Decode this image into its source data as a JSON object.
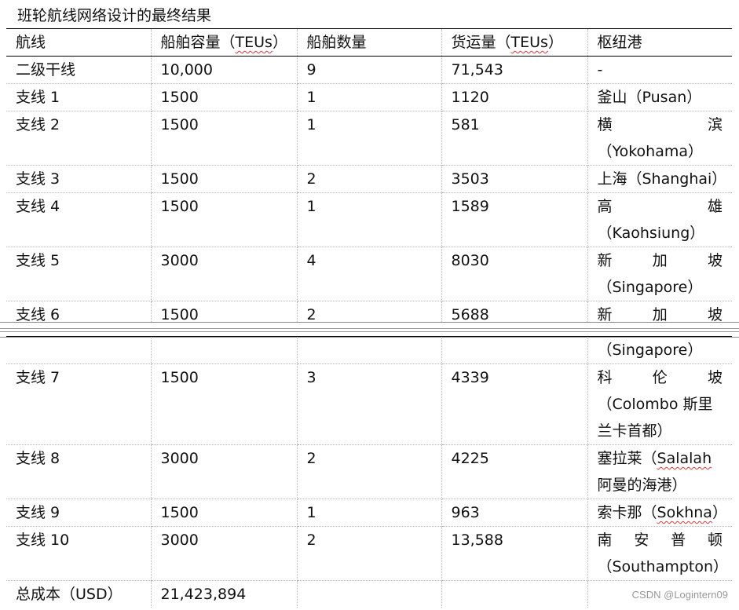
{
  "caption": "班轮航线网络设计的最终结果",
  "headers": {
    "route": "航线",
    "capacity_prefix": "船舶容量（",
    "capacity_unit": "TEUs",
    "capacity_suffix": "）",
    "ship_count": "船舶数量",
    "volume_prefix": "货运量（",
    "volume_unit": "TEUs",
    "volume_suffix": "）",
    "hub": "枢纽港"
  },
  "rows": [
    {
      "route": "二级干线",
      "capacity": "10,000",
      "ships": "9",
      "volume": "71,543",
      "hub": "-"
    },
    {
      "route": "支线 1",
      "capacity": "1500",
      "ships": "1",
      "volume": "1120",
      "hub": "釜山（Pusan）"
    },
    {
      "route": "支线 2",
      "capacity": "1500",
      "ships": "1",
      "volume": "581",
      "hub_chars": [
        "横",
        "滨"
      ],
      "hub_line2": "（Yokohama）"
    },
    {
      "route": "支线 3",
      "capacity": "1500",
      "ships": "2",
      "volume": "3503",
      "hub": "上海（Shanghai）"
    },
    {
      "route": "支线 4",
      "capacity": "1500",
      "ships": "1",
      "volume": "1589",
      "hub_chars": [
        "高",
        "雄"
      ],
      "hub_line2": "（Kaohsiung）"
    },
    {
      "route": "支线 5",
      "capacity": "3000",
      "ships": "4",
      "volume": "8030",
      "hub_chars": [
        "新",
        "加",
        "坡"
      ],
      "hub_line2": "（Singapore）"
    },
    {
      "route": "支线 6",
      "capacity": "1500",
      "ships": "2",
      "volume": "5688",
      "hub_chars": [
        "新",
        "加",
        "坡"
      ],
      "hub_line2": "（Singapore）"
    },
    {
      "route": "支线 7",
      "capacity": "1500",
      "ships": "3",
      "volume": "4339",
      "hub_chars": [
        "科",
        "伦",
        "坡"
      ],
      "hub_line2": "（Colombo 斯里",
      "hub_line3": "兰卡首都）"
    },
    {
      "route": "支线 8",
      "capacity": "3000",
      "ships": "2",
      "volume": "4225",
      "hub_line1_prefix": "塞拉莱（",
      "hub_line1_word": "Salalah",
      "hub_line2": "阿曼的海港）"
    },
    {
      "route": "支线 9",
      "capacity": "1500",
      "ships": "1",
      "volume": "963",
      "hub_prefix": "索卡那（",
      "hub_word": "Sokhna",
      "hub_suffix": "）"
    },
    {
      "route": "支线 10",
      "capacity": "3000",
      "ships": "2",
      "volume": "13,588",
      "hub_chars": [
        "南",
        "安",
        "普",
        "顿"
      ],
      "hub_line2": "（Southampton）"
    }
  ],
  "total": {
    "label": "总成本（USD）",
    "value": "21,423,894"
  },
  "watermark": "CSDN @Logintern09"
}
